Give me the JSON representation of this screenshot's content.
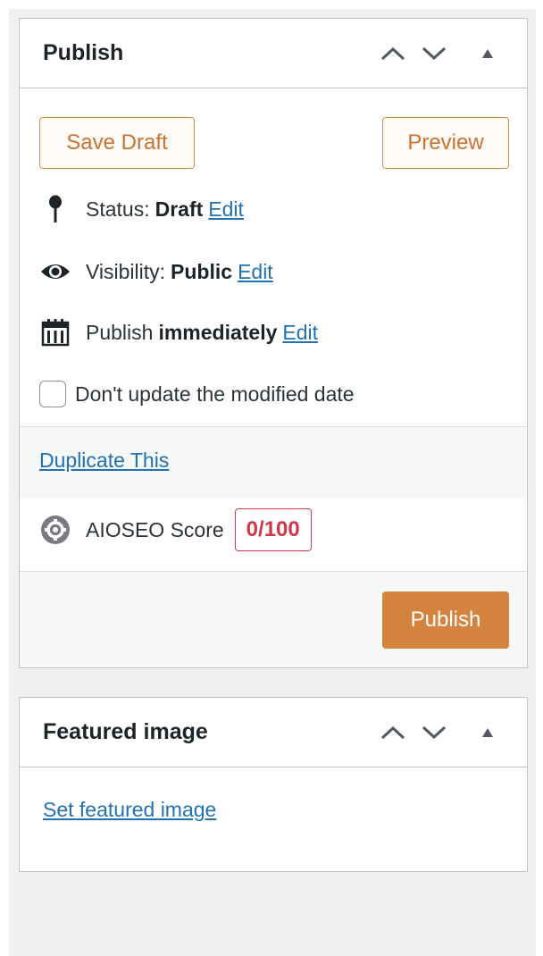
{
  "publish_box": {
    "title": "Publish",
    "save_draft_label": "Save Draft",
    "preview_label": "Preview",
    "status": {
      "label": "Status:",
      "value": "Draft",
      "edit": "Edit"
    },
    "visibility": {
      "label": "Visibility:",
      "value": "Public",
      "edit": "Edit"
    },
    "schedule": {
      "label": "Publish",
      "value": "immediately",
      "edit": "Edit"
    },
    "modified_checkbox_label": "Don't update the modified date",
    "duplicate_link": "Duplicate This",
    "aioseo": {
      "label": "AIOSEO Score",
      "score": "0/100"
    },
    "publish_button": "Publish"
  },
  "featured_box": {
    "title": "Featured image",
    "set_link": "Set featured image"
  },
  "colors": {
    "accent_orange": "#d5843f",
    "link_blue": "#2271b1",
    "score_red": "#d0384a",
    "border_gray": "#c3c4c7"
  },
  "icons": {
    "status": "pin-icon",
    "visibility": "eye-icon",
    "schedule": "calendar-icon",
    "aioseo": "aioseo-gear-icon",
    "move_up": "chevron-up-icon",
    "move_down": "chevron-down-icon",
    "toggle": "triangle-up-icon"
  }
}
